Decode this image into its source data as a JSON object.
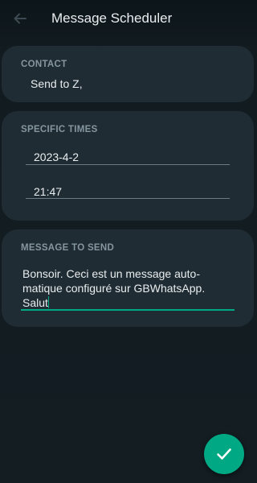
{
  "header": {
    "title": "Message Scheduler",
    "back_icon": "arrow-left-icon"
  },
  "contact": {
    "label": "CONTACT",
    "value": "Send to Z,"
  },
  "times": {
    "label": "SPECIFIC TIMES",
    "date": "2023-4-2",
    "time": "21:47"
  },
  "message": {
    "label": "MESSAGE TO SEND",
    "line1": "Bonsoir. Ceci est un message auto-",
    "line2": "matique configuré sur GBWhatsApp.",
    "line3": "Salut"
  },
  "fab": {
    "icon": "checkmark-icon"
  },
  "colors": {
    "accent": "#00a884",
    "card": "#1f2c33",
    "label": "#8696a0"
  }
}
